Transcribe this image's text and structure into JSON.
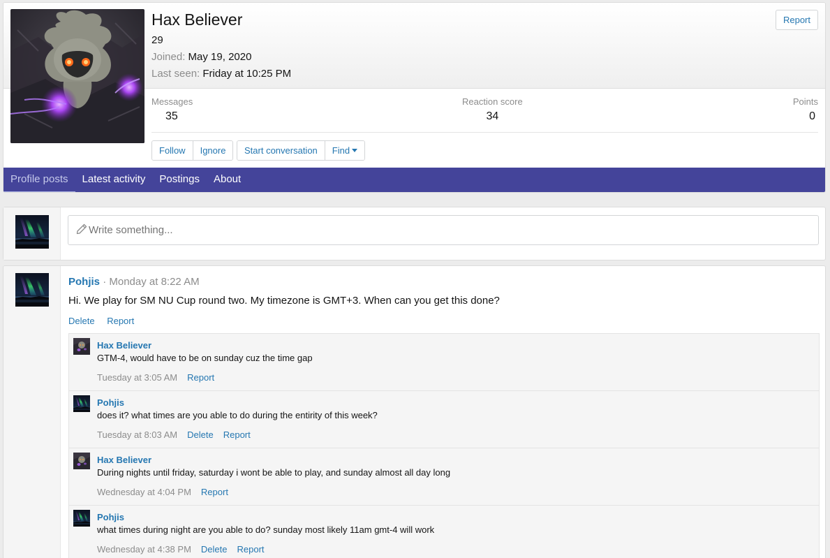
{
  "profile": {
    "name": "Hax Believer",
    "title": "29",
    "joined_label": "Joined:",
    "joined_value": "May 19, 2020",
    "last_seen_label": "Last seen:",
    "last_seen_value": "Friday at 10:25 PM",
    "report_label": "Report",
    "stats": {
      "messages_label": "Messages",
      "messages_value": "35",
      "reaction_label": "Reaction score",
      "reaction_value": "34",
      "points_label": "Points",
      "points_value": "0"
    },
    "buttons": {
      "follow": "Follow",
      "ignore": "Ignore",
      "start_conversation": "Start conversation",
      "find": "Find"
    }
  },
  "tabs": [
    {
      "label": "Profile posts",
      "active": true
    },
    {
      "label": "Latest activity",
      "active": false
    },
    {
      "label": "Postings",
      "active": false
    },
    {
      "label": "About",
      "active": false
    }
  ],
  "composer": {
    "placeholder": "Write something..."
  },
  "post": {
    "author": "Pohjis",
    "separator": "·",
    "time": "Monday at 8:22 AM",
    "body": "Hi. We play for SM NU Cup round two. My timezone is GMT+3. When can you get this done?",
    "delete_label": "Delete",
    "report_label": "Report",
    "comments": [
      {
        "author": "Hax Believer",
        "text": "GTM-4, would have to be on sunday cuz the time gap",
        "time": "Tuesday at 3:05 AM",
        "report_label": "Report"
      },
      {
        "author": "Pohjis",
        "text": "does it? what times are you able to do during the entirity of this week?",
        "time": "Tuesday at 8:03 AM",
        "delete_label": "Delete",
        "report_label": "Report"
      },
      {
        "author": "Hax Believer",
        "text": "During nights until friday, saturday i wont be able to play, and sunday almost all day long",
        "time": "Wednesday at 4:04 PM",
        "report_label": "Report"
      },
      {
        "author": "Pohjis",
        "text": "what times during night are you able to do? sunday most likely 11am gmt-4 will work",
        "time": "Wednesday at 4:38 PM",
        "delete_label": "Delete",
        "report_label": "Report"
      }
    ]
  },
  "colors": {
    "link": "#2577b1",
    "tab_bar": "#44449a",
    "muted": "#8c8c8c"
  },
  "icons": {
    "composer": "pencil-icon"
  }
}
